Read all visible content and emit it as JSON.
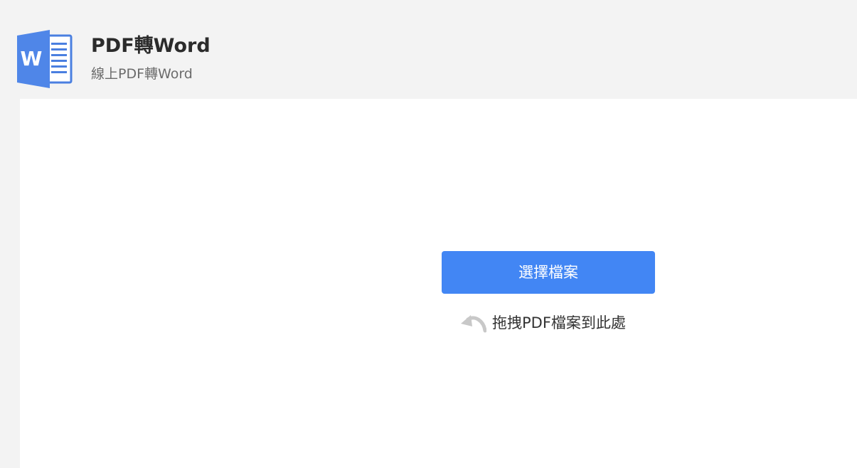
{
  "header": {
    "icon": "word-document-icon",
    "icon_letter": "W",
    "title": "PDF轉Word",
    "subtitle": "線上PDF轉Word"
  },
  "upload": {
    "button_label": "選擇檔案",
    "drop_icon": "curved-arrow-icon",
    "drop_hint": "拖拽PDF檔案到此處"
  },
  "colors": {
    "background": "#f3f3f3",
    "panel": "#ffffff",
    "accent": "#4286f4",
    "word_blue": "#3f78e0"
  }
}
